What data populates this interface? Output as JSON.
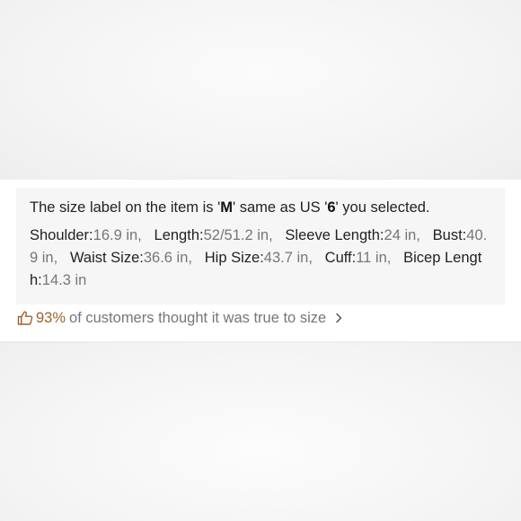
{
  "size_info": {
    "headline_prefix": "The size label on the item is '",
    "size_label": "M",
    "headline_middle": "' same as US '",
    "us_size": "6",
    "headline_suffix": "' you selected.",
    "measurements": [
      {
        "label": "Shoulder:",
        "value": "16.9 in,"
      },
      {
        "label": "Length:",
        "value": "52/51.2 in,"
      },
      {
        "label": "Sleeve Length:",
        "value": "24 in,"
      },
      {
        "label": "Bust:",
        "value": "40.9 in,"
      },
      {
        "label": "Waist Size:",
        "value": "36.6 in,"
      },
      {
        "label": "Hip Size:",
        "value": "43.7 in,"
      },
      {
        "label": "Cuff:",
        "value": "11 in,"
      },
      {
        "label": "Bicep Length:",
        "value": "14.3 in"
      }
    ]
  },
  "fit_feedback": {
    "icon": "thumbs-up-icon",
    "percent": "93%",
    "text": "of customers thought it was true to size",
    "chevron_icon": "chevron-right-icon"
  },
  "colors": {
    "accent": "#a0612a",
    "value_gray": "#767676",
    "box_bg": "#f6f6f6"
  }
}
